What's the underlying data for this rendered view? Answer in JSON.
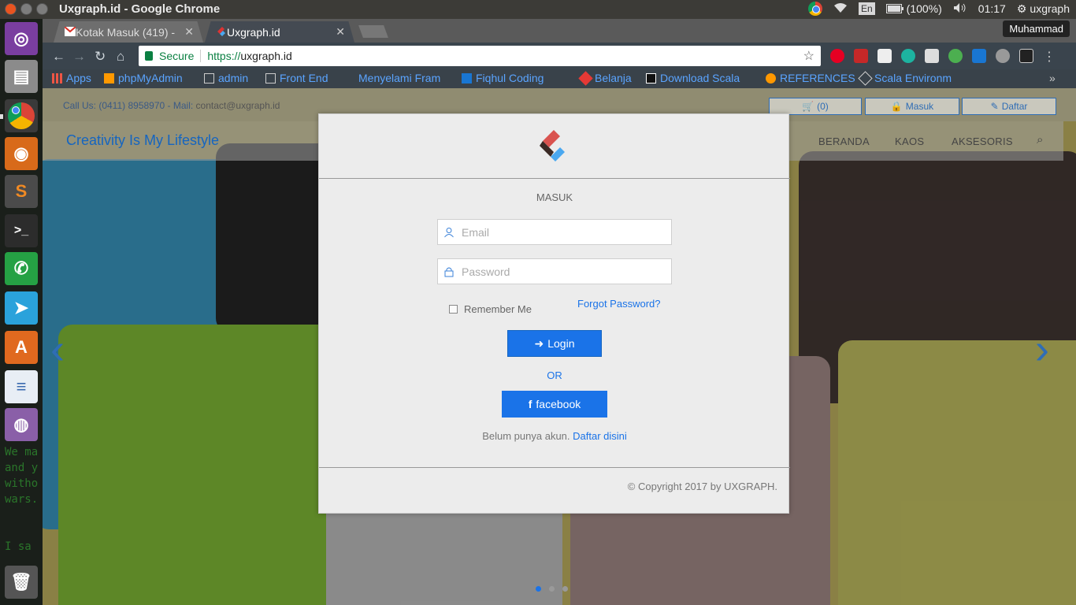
{
  "system": {
    "window_title": "Uxgraph.id - Google Chrome",
    "lang": "En",
    "battery": "(100%)",
    "clock": "01:17",
    "user": "uxgraph"
  },
  "chrome": {
    "tabs": [
      {
        "label": "Kotak Masuk (419) -"
      },
      {
        "label": "Uxgraph.id"
      }
    ],
    "profile_badge": "Muhammad",
    "secure_label": "Secure",
    "url_scheme": "https://",
    "url_host": "uxgraph.id",
    "bookmarks": [
      {
        "label": "Apps"
      },
      {
        "label": "phpMyAdmin"
      },
      {
        "label": "admin"
      },
      {
        "label": "Front End"
      },
      {
        "label": "Menyelami Fram"
      },
      {
        "label": "Fiqhul Coding"
      },
      {
        "label": "Belanja"
      },
      {
        "label": "Download Scala"
      },
      {
        "label": "REFERENCES"
      },
      {
        "label": "Scala Environm"
      }
    ],
    "bookmarks_overflow": "»"
  },
  "launcher_terminal_text": "We ma\nand y\nwitho\nwars.\n\n\nI sa",
  "site": {
    "callus": "Call Us: (0411) 8958970 - Mail:",
    "mail": "contact@uxgraph.id",
    "cart": "(0)",
    "masuk": "Masuk",
    "daftar": "Daftar",
    "brand": "Creativity Is My Lifestyle",
    "menu": [
      "BERANDA",
      "KAOS",
      "AKSESORIS"
    ]
  },
  "modal": {
    "title": "MASUK",
    "email_placeholder": "Email",
    "password_placeholder": "Password",
    "remember": "Remember Me",
    "forgot": "Forgot Password?",
    "login": "Login",
    "or": "OR",
    "facebook": "facebook",
    "signup_text": "Belum punya akun.",
    "signup_link": "Daftar disini",
    "copyright": "© Copyright 2017 by UXGRAPH."
  },
  "colors": {
    "accent": "#1a73e8",
    "ubuntu_orange": "#e95420",
    "brand_blue": "#1565c0"
  }
}
